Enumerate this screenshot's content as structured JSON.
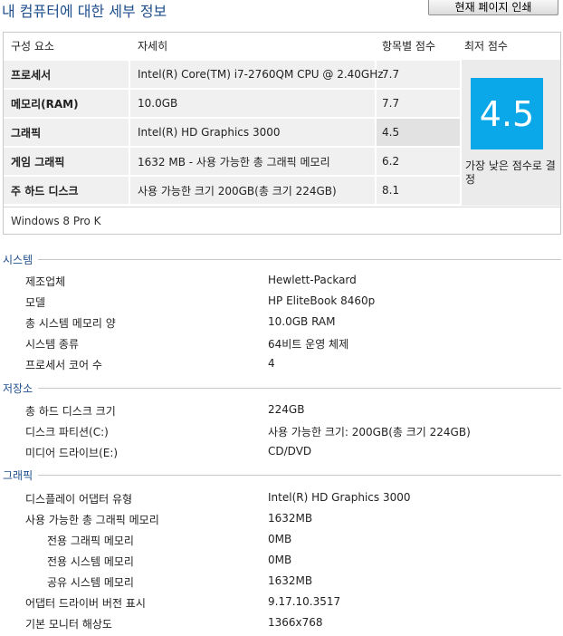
{
  "header": {
    "title": "내 컴퓨터에 대한 세부 정보",
    "print_label": "현재 페이지 인쇄"
  },
  "score_table": {
    "columns": [
      "구성 요소",
      "자세히",
      "항목별 점수",
      "최저 점수"
    ],
    "rows": [
      {
        "component": "프로세서",
        "detail": "Intel(R) Core(TM) i7-2760QM CPU @ 2.40GHz",
        "score": "7.7"
      },
      {
        "component": "메모리(RAM)",
        "detail": "10.0GB",
        "score": "7.7"
      },
      {
        "component": "그래픽",
        "detail": "Intel(R) HD Graphics 3000",
        "score": "4.5"
      },
      {
        "component": "게임 그래픽",
        "detail": "1632 MB - 사용 가능한 총 그래픽 메모리",
        "score": "6.2"
      },
      {
        "component": "주 하드 디스크",
        "detail": "사용 가능한 크기 200GB(총 크기 224GB)",
        "score": "8.1"
      }
    ],
    "base_score": "4.5",
    "base_score_caption": "가장 낮은 점수로 결정",
    "os": "Windows 8 Pro K",
    "tile_color": "#0aa8e8"
  },
  "sections": [
    {
      "title": "시스템",
      "rows": [
        {
          "label": "제조업체",
          "value": "Hewlett-Packard"
        },
        {
          "label": "모델",
          "value": "HP EliteBook 8460p"
        },
        {
          "label": "총 시스템 메모리 양",
          "value": "10.0GB RAM"
        },
        {
          "label": "시스템 종류",
          "value": "64비트 운영 체제"
        },
        {
          "label": "프로세서 코어 수",
          "value": "4"
        }
      ]
    },
    {
      "title": "저장소",
      "rows": [
        {
          "label": "총 하드 디스크 크기",
          "value": "224GB"
        },
        {
          "label": "디스크 파티션(C:)",
          "value": "사용 가능한 크기: 200GB(총 크기 224GB)"
        },
        {
          "label": "미디어 드라이브(E:)",
          "value": "CD/DVD"
        }
      ]
    },
    {
      "title": "그래픽",
      "rows": [
        {
          "label": "디스플레이 어댑터 유형",
          "value": "Intel(R) HD Graphics 3000"
        },
        {
          "label": "사용 가능한 총 그래픽 메모리",
          "value": "1632MB"
        },
        {
          "label": "전용 그래픽 메모리",
          "value": "0MB"
        },
        {
          "label": "전용 시스템 메모리",
          "value": "0MB"
        },
        {
          "label": "공유 시스템 메모리",
          "value": "1632MB"
        },
        {
          "label": "어댑터 드라이버 버전 표시",
          "value": "9.17.10.3517"
        },
        {
          "label": "기본 모니터 해상도",
          "value": "1366x768"
        }
      ]
    }
  ]
}
